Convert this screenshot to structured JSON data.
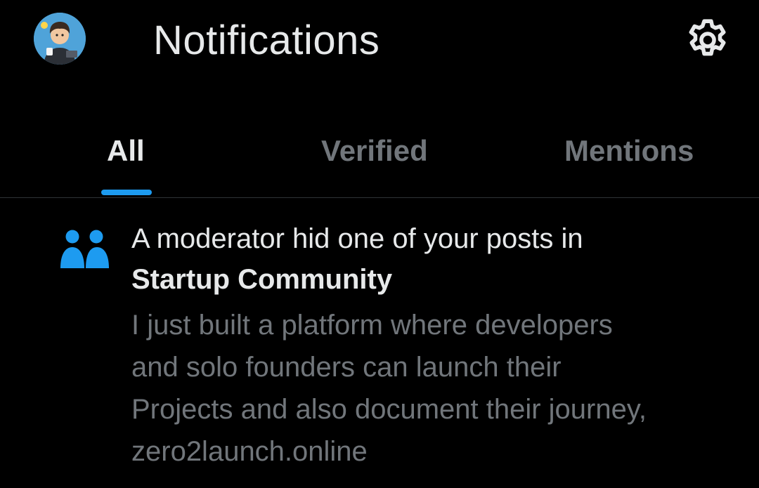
{
  "header": {
    "title": "Notifications",
    "avatar_icon": "user-avatar",
    "settings_icon": "gear-icon"
  },
  "tabs": [
    {
      "label": "All",
      "active": true
    },
    {
      "label": "Verified",
      "active": false
    },
    {
      "label": "Mentions",
      "active": false
    }
  ],
  "notification": {
    "icon": "community-icon",
    "headline": "A moderator hid one of your posts in",
    "community": "Startup Community",
    "post_lines": [
      "I just built a platform where developers",
      "and solo founders can launch their",
      "Projects and also document their journey,",
      "zero2launch.online"
    ]
  },
  "colors": {
    "background": "#000000",
    "primary_text": "#e7e9ea",
    "secondary_text": "#71767b",
    "accent": "#1d9bf0",
    "divider": "#2f3336"
  }
}
